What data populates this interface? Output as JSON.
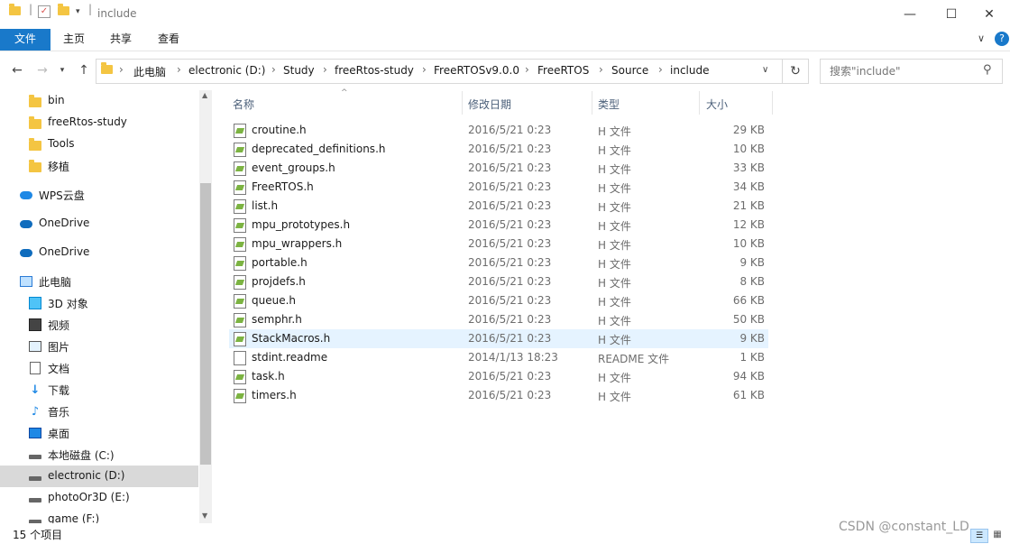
{
  "window": {
    "title": "include",
    "controls": [
      "minimize",
      "maximize",
      "close"
    ]
  },
  "ribbon": {
    "tabs": [
      "文件",
      "主页",
      "共享",
      "查看"
    ]
  },
  "address": {
    "crumbs": [
      "此电脑",
      "electronic (D:)",
      "Study",
      "freeRtos-study",
      "FreeRTOSv9.0.0",
      "FreeRTOS",
      "Source",
      "include"
    ]
  },
  "search": {
    "placeholder": "搜索\"include\""
  },
  "nav": {
    "items": [
      {
        "label": "bin",
        "icon": "folder-icon"
      },
      {
        "label": "freeRtos-study",
        "icon": "folder-icon"
      },
      {
        "label": "Tools",
        "icon": "folder-icon"
      },
      {
        "label": "移植",
        "icon": "folder-icon"
      },
      {
        "label": "WPS云盘",
        "icon": "wps-cloud-icon"
      },
      {
        "label": "OneDrive",
        "icon": "onedrive-icon"
      },
      {
        "label": "OneDrive",
        "icon": "onedrive-icon"
      },
      {
        "label": "此电脑",
        "icon": "this-pc-icon"
      },
      {
        "label": "3D 对象",
        "icon": "3d-objects-icon"
      },
      {
        "label": "视频",
        "icon": "video-icon"
      },
      {
        "label": "图片",
        "icon": "pictures-icon"
      },
      {
        "label": "文档",
        "icon": "documents-icon"
      },
      {
        "label": "下载",
        "icon": "download-icon"
      },
      {
        "label": "音乐",
        "icon": "music-icon"
      },
      {
        "label": "桌面",
        "icon": "desktop-icon"
      },
      {
        "label": "本地磁盘 (C:)",
        "icon": "drive-icon"
      },
      {
        "label": "electronic (D:)",
        "icon": "drive-icon",
        "selected": true
      },
      {
        "label": "photoOr3D (E:)",
        "icon": "drive-icon"
      },
      {
        "label": "game (F:)",
        "icon": "drive-icon"
      }
    ]
  },
  "columns": {
    "name": "名称",
    "date": "修改日期",
    "type": "类型",
    "size": "大小"
  },
  "files": [
    {
      "name": "croutine.h",
      "date": "2016/5/21 0:23",
      "type": "H 文件",
      "size": "29 KB"
    },
    {
      "name": "deprecated_definitions.h",
      "date": "2016/5/21 0:23",
      "type": "H 文件",
      "size": "10 KB"
    },
    {
      "name": "event_groups.h",
      "date": "2016/5/21 0:23",
      "type": "H 文件",
      "size": "33 KB"
    },
    {
      "name": "FreeRTOS.h",
      "date": "2016/5/21 0:23",
      "type": "H 文件",
      "size": "34 KB"
    },
    {
      "name": "list.h",
      "date": "2016/5/21 0:23",
      "type": "H 文件",
      "size": "21 KB"
    },
    {
      "name": "mpu_prototypes.h",
      "date": "2016/5/21 0:23",
      "type": "H 文件",
      "size": "12 KB"
    },
    {
      "name": "mpu_wrappers.h",
      "date": "2016/5/21 0:23",
      "type": "H 文件",
      "size": "10 KB"
    },
    {
      "name": "portable.h",
      "date": "2016/5/21 0:23",
      "type": "H 文件",
      "size": "9 KB"
    },
    {
      "name": "projdefs.h",
      "date": "2016/5/21 0:23",
      "type": "H 文件",
      "size": "8 KB"
    },
    {
      "name": "queue.h",
      "date": "2016/5/21 0:23",
      "type": "H 文件",
      "size": "66 KB"
    },
    {
      "name": "semphr.h",
      "date": "2016/5/21 0:23",
      "type": "H 文件",
      "size": "50 KB"
    },
    {
      "name": "StackMacros.h",
      "date": "2016/5/21 0:23",
      "type": "H 文件",
      "size": "9 KB",
      "highlighted": true
    },
    {
      "name": "stdint.readme",
      "date": "2014/1/13 18:23",
      "type": "README 文件",
      "size": "1 KB"
    },
    {
      "name": "task.h",
      "date": "2016/5/21 0:23",
      "type": "H 文件",
      "size": "94 KB"
    },
    {
      "name": "timers.h",
      "date": "2016/5/21 0:23",
      "type": "H 文件",
      "size": "61 KB"
    }
  ],
  "status": {
    "count": "15 个项目"
  },
  "watermark": "CSDN @constant_LD"
}
